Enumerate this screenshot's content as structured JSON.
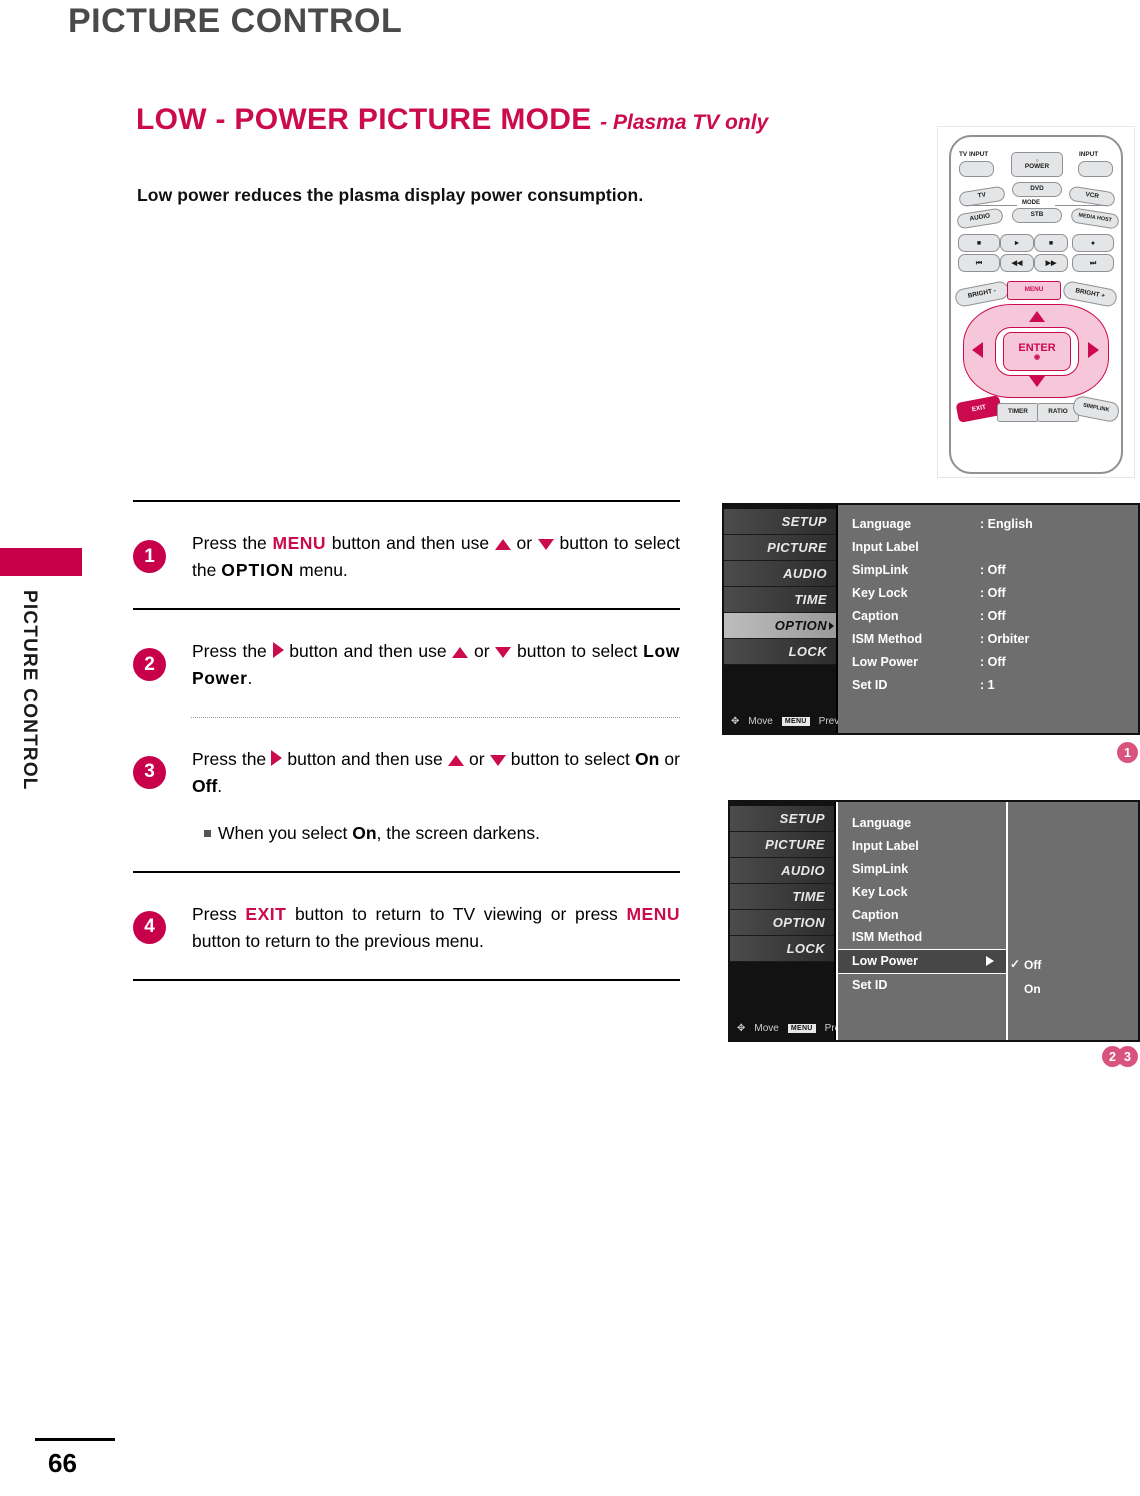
{
  "page": {
    "header": "PICTURE CONTROL",
    "side_tab_label": "PICTURE CONTROL",
    "number": "66"
  },
  "section": {
    "title": "LOW - POWER PICTURE MODE",
    "subtitle": "- Plasma TV only",
    "intro": "Low power reduces the plasma display power consumption."
  },
  "steps": [
    {
      "number": "1",
      "parts": {
        "t1": "Press the ",
        "kw1": "MENU",
        "t2": " button and then use ",
        "t3": " or ",
        "t4": " button to select the ",
        "kw2": "OPTION",
        "t5": " menu."
      }
    },
    {
      "number": "2",
      "parts": {
        "t1": "Press the ",
        "t2": " button and then use ",
        "t3": " or ",
        "t4": " button to select ",
        "kw1": "Low Power",
        "t5": "."
      }
    },
    {
      "number": "3",
      "parts": {
        "t1": "Press the ",
        "t2": " button and then use ",
        "t3": " or ",
        "t4": " button to select ",
        "kw1": "On",
        "t5": " or ",
        "kw2": "Off",
        "t6": "."
      },
      "note": {
        "t1": "When you select ",
        "kw1": "On",
        "t2": ", the screen darkens."
      }
    },
    {
      "number": "4",
      "parts": {
        "t1": "Press ",
        "kw1": "EXIT",
        "t2": " button to return to TV viewing or press ",
        "kw2": "MENU",
        "t3": " button to return to the previous menu."
      }
    }
  ],
  "remote": {
    "tv_input": "TV INPUT",
    "power": "POWER",
    "input": "INPUT",
    "tv": "TV",
    "dvd": "DVD",
    "vcr": "VCR",
    "mode": "MODE",
    "audio": "AUDIO",
    "stb": "STB",
    "media_host": "MEDIA HOST",
    "bright_minus": "BRIGHT -",
    "menu": "MENU",
    "bright_plus": "BRIGHT +",
    "enter": "ENTER",
    "exit": "EXIT",
    "timer": "TIMER",
    "ratio": "RATIO",
    "simplink": "SIMPLINK"
  },
  "osd1": {
    "side_items": [
      {
        "label": "SETUP",
        "active": false
      },
      {
        "label": "PICTURE",
        "active": false
      },
      {
        "label": "AUDIO",
        "active": false
      },
      {
        "label": "TIME",
        "active": false
      },
      {
        "label": "OPTION",
        "active": true
      },
      {
        "label": "LOCK",
        "active": false
      }
    ],
    "foot_move": "Move",
    "foot_menu_chip": "MENU",
    "foot_prev": "Prev",
    "rows": [
      {
        "label": "Language",
        "value": ": English"
      },
      {
        "label": "Input Label",
        "value": ""
      },
      {
        "label": "SimpLink",
        "value": ": Off"
      },
      {
        "label": "Key Lock",
        "value": ": Off"
      },
      {
        "label": "Caption",
        "value": ": Off"
      },
      {
        "label": "ISM Method",
        "value": ": Orbiter"
      },
      {
        "label": "Low Power",
        "value": ": Off"
      },
      {
        "label": "Set ID",
        "value": ": 1"
      }
    ],
    "marker": "1"
  },
  "osd2": {
    "side_items": [
      {
        "label": "SETUP",
        "active": false
      },
      {
        "label": "PICTURE",
        "active": false
      },
      {
        "label": "AUDIO",
        "active": false
      },
      {
        "label": "TIME",
        "active": false
      },
      {
        "label": "OPTION",
        "active": false
      },
      {
        "label": "LOCK",
        "active": false
      }
    ],
    "foot_move": "Move",
    "foot_menu_chip": "MENU",
    "foot_prev": "Prev",
    "rows": [
      {
        "label": "Language",
        "selected": false
      },
      {
        "label": "Input Label",
        "selected": false
      },
      {
        "label": "SimpLink",
        "selected": false
      },
      {
        "label": "Key Lock",
        "selected": false
      },
      {
        "label": "Caption",
        "selected": false
      },
      {
        "label": "ISM Method",
        "selected": false
      },
      {
        "label": "Low Power",
        "selected": true
      },
      {
        "label": "Set ID",
        "selected": false
      }
    ],
    "options": [
      {
        "label": "Off",
        "checked": true
      },
      {
        "label": "On",
        "checked": false
      }
    ],
    "markers": [
      "2",
      "3"
    ]
  },
  "colors": {
    "brand_pink": "#cc0a4e",
    "tab_pink": "#c8004b",
    "marker_pink": "#d9537f",
    "header_gray": "#4a4a4a",
    "osd_bg": "#6e6e6e",
    "osd_side": "#121212"
  }
}
